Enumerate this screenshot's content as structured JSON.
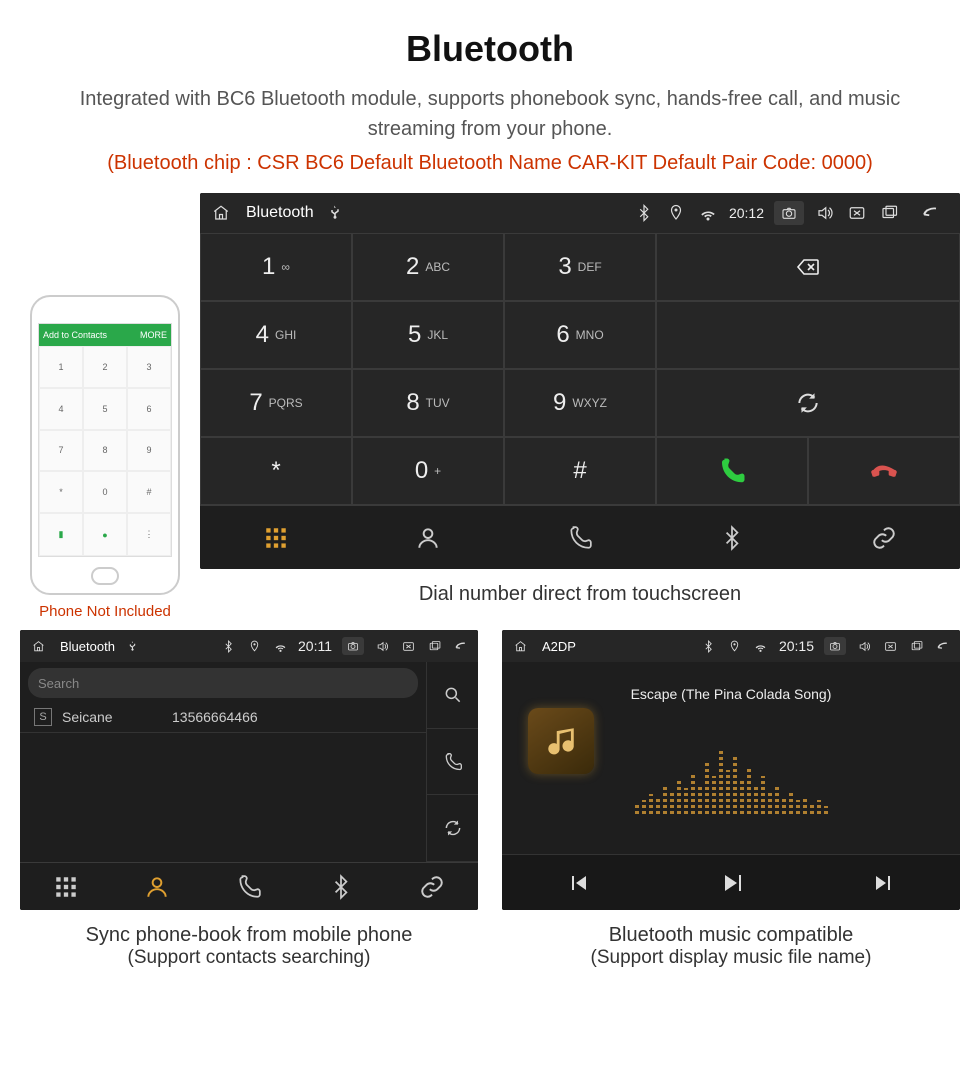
{
  "header": {
    "title": "Bluetooth",
    "description": "Integrated with BC6 Bluetooth module, supports phonebook sync, hands-free call, and music streaming from your phone.",
    "spec": "(Bluetooth chip : CSR BC6     Default Bluetooth Name CAR-KIT     Default Pair Code: 0000)"
  },
  "phone_mock": {
    "bar_left": "Add to Contacts",
    "bar_right": "MORE",
    "caption": "Phone Not Included"
  },
  "dialer": {
    "status": {
      "title": "Bluetooth",
      "time": "20:12"
    },
    "keys": [
      {
        "num": "1",
        "letters": "∞"
      },
      {
        "num": "2",
        "letters": "ABC"
      },
      {
        "num": "3",
        "letters": "DEF"
      },
      {
        "num": "4",
        "letters": "GHI"
      },
      {
        "num": "5",
        "letters": "JKL"
      },
      {
        "num": "6",
        "letters": "MNO"
      },
      {
        "num": "7",
        "letters": "PQRS"
      },
      {
        "num": "8",
        "letters": "TUV"
      },
      {
        "num": "9",
        "letters": "WXYZ"
      },
      {
        "num": "*",
        "letters": ""
      },
      {
        "num": "0",
        "letters": "+"
      },
      {
        "num": "#",
        "letters": ""
      }
    ],
    "caption": "Dial number direct from touchscreen"
  },
  "contacts": {
    "status": {
      "title": "Bluetooth",
      "time": "20:11"
    },
    "search_placeholder": "Search",
    "entry": {
      "badge": "S",
      "name": "Seicane",
      "number": "13566664466"
    },
    "caption1": "Sync phone-book from mobile phone",
    "caption2": "(Support contacts searching)"
  },
  "music": {
    "status": {
      "title": "A2DP",
      "time": "20:15"
    },
    "track": "Escape (The Pina Colada Song)",
    "bars": [
      10,
      14,
      20,
      16,
      28,
      22,
      34,
      26,
      40,
      30,
      52,
      38,
      64,
      44,
      58,
      36,
      46,
      30,
      38,
      24,
      30,
      18,
      22,
      14,
      18,
      10,
      14,
      8
    ],
    "caption1": "Bluetooth music compatible",
    "caption2": "(Support display music file name)"
  }
}
